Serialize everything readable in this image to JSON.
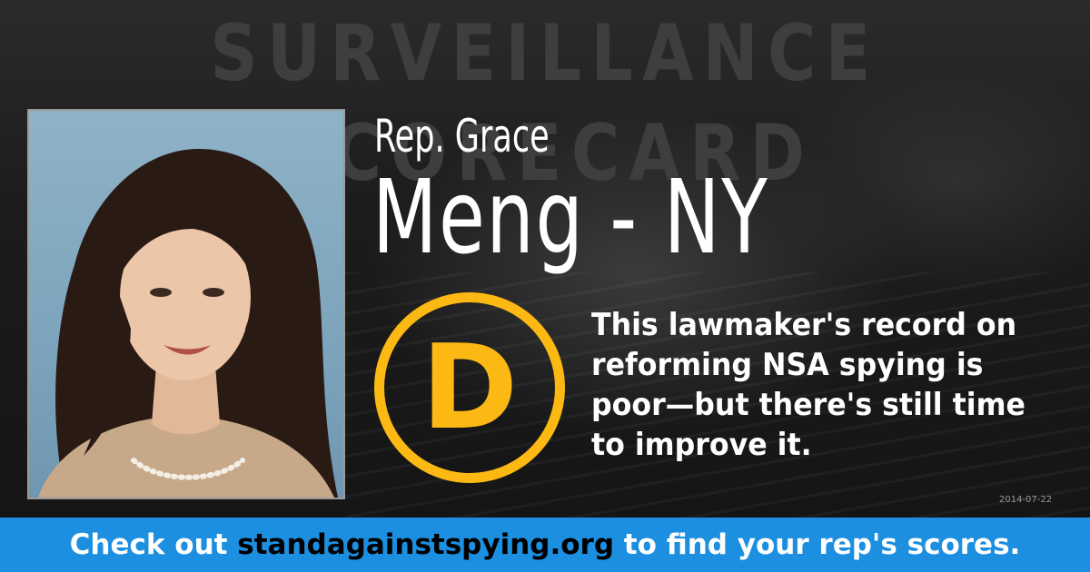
{
  "header": {
    "title": "SURVEILLANCE SCORECARD"
  },
  "rep": {
    "title_first": "Rep. Grace",
    "last_state": "Meng - NY",
    "grade": "D",
    "description": "This lawmaker's record on reforming NSA spying is poor—but there's still time to improve it.",
    "date": "2014-07-22"
  },
  "banner": {
    "prefix": "Check out ",
    "site": "standagainstspying.org",
    "suffix": " to find your rep's scores."
  },
  "colors": {
    "grade_accent": "#fcb813",
    "banner_bg": "#1c8fe0",
    "photo_bg": "#7ca4bc"
  }
}
